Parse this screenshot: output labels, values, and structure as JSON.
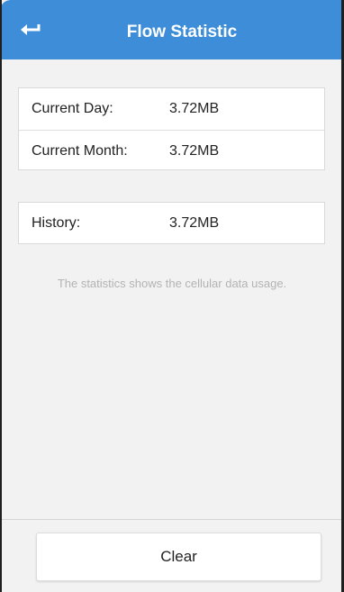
{
  "header": {
    "title": "Flow Statistic",
    "back_icon": "back-arrow-icon",
    "background_color": "#3d8dd8"
  },
  "usage": {
    "rows": [
      {
        "label": "Current Day:",
        "value": "3.72MB"
      },
      {
        "label": "Current Month:",
        "value": "3.72MB"
      }
    ],
    "history": {
      "label": "History:",
      "value": "3.72MB"
    }
  },
  "hint": "The statistics shows the cellular data usage.",
  "footer": {
    "clear_label": "Clear"
  }
}
